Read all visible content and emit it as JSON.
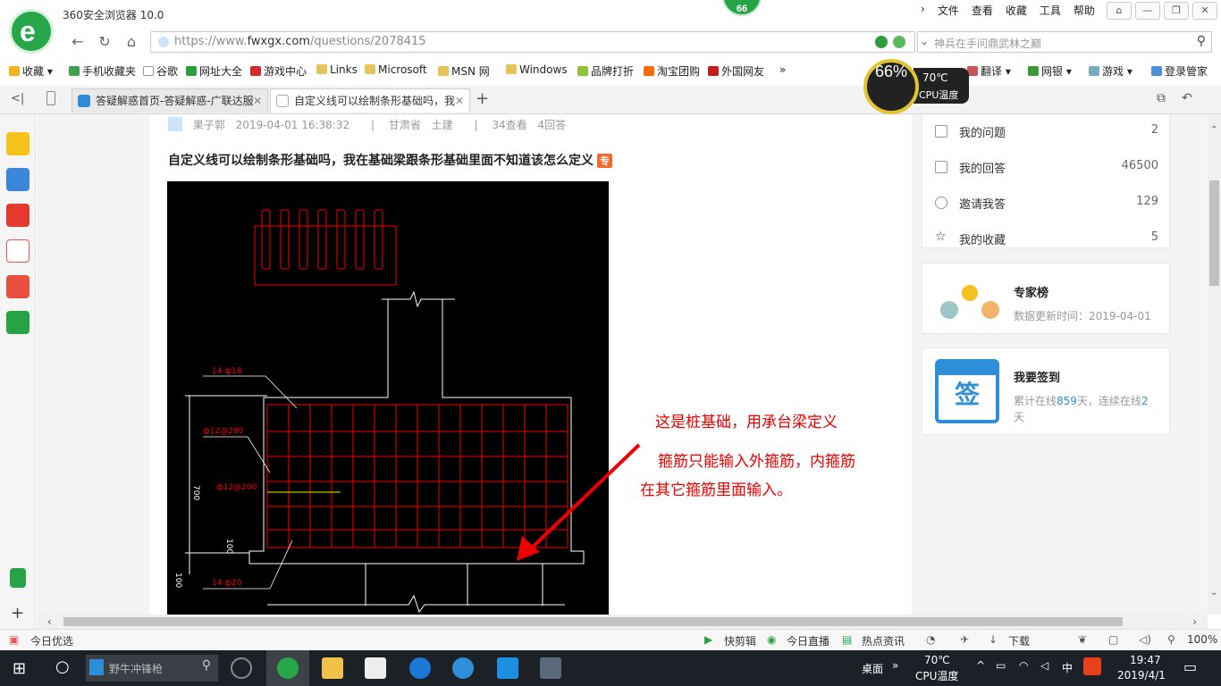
{
  "browser": {
    "app_title": "360安全浏览器 10.0",
    "badge": "66",
    "menu": [
      "文件",
      "查看",
      "收藏",
      "工具",
      "帮助"
    ],
    "url_prefix": "https://www.",
    "url_domain": "fwxgx.com",
    "url_path": "/questions/2078415",
    "search_placeholder": "神兵在手问鼎武林之巅"
  },
  "bookmarks": [
    {
      "label": "收藏",
      "color": "#f2b51d"
    },
    {
      "label": "手机收藏夹",
      "color": "#3fa34d"
    },
    {
      "label": "谷歌",
      "color": "#bbbbbb"
    },
    {
      "label": "网址大全",
      "color": "#2e9e3c"
    },
    {
      "label": "游戏中心",
      "color": "#d42a2a"
    },
    {
      "label": "Links",
      "color": "#e8c25a"
    },
    {
      "label": "Microsoft",
      "color": "#e8c25a"
    },
    {
      "label": "MSN 网",
      "color": "#e8c25a"
    },
    {
      "label": "Windows",
      "color": "#e8c25a"
    },
    {
      "label": "品牌打折",
      "color": "#8fc33a"
    },
    {
      "label": "淘宝团购",
      "color": "#ff6a00"
    },
    {
      "label": "外国网友",
      "color": "#c81b1b"
    },
    {
      "label": "翻译",
      "color": "#c55"
    },
    {
      "label": "网银",
      "color": "#3a9a3a"
    },
    {
      "label": "游戏",
      "color": "#7ab"
    },
    {
      "label": "登录管家",
      "color": "#4a90d9"
    }
  ],
  "tabs": [
    {
      "label": "答疑解惑首页-答疑解惑-广联达服",
      "active": false,
      "color": "#2f8bd8"
    },
    {
      "label": "自定义线可以绘制条形基础吗，我",
      "active": true,
      "color": "#cccccc"
    }
  ],
  "cpu": {
    "percent": "66%",
    "temp": "70℃",
    "label": "CPU温度"
  },
  "question": {
    "author": "果子郭",
    "date": "2019-04-01 16:38:32",
    "location": "甘肃省",
    "category": "土建",
    "views": "34查看",
    "answers": "4回答",
    "title": "自定义线可以绘制条形基础吗，我在基础梁跟条形基础里面不知道该怎么定义",
    "badge": "专"
  },
  "cad_labels": {
    "top_rebar": "14 ф18",
    "stirrup": "ф12@280",
    "mid_rebar": "ф12@200",
    "height": "700",
    "base": "100",
    "bottom_rebar": "14 ф20",
    "small": "100"
  },
  "annotation": {
    "line1": "这是桩基础，用承台梁定义",
    "line2": "箍筋只能输入外箍筋，内箍筋",
    "line3": "在其它箍筋里面输入。"
  },
  "user_stats": [
    {
      "label": "我的问题",
      "value": "2"
    },
    {
      "label": "我的回答",
      "value": "46500"
    },
    {
      "label": "邀请我答",
      "value": "129"
    },
    {
      "label": "我的收藏",
      "value": "5"
    }
  ],
  "expert": {
    "title": "专家榜",
    "subtitle": "数据更新时间：2019-04-01"
  },
  "signin": {
    "title": "我要签到",
    "icon_text": "签",
    "line_a": "累计在线",
    "days_total": "859",
    "line_b": "天，连续在线",
    "days_streak": "2",
    "line_c": "天"
  },
  "statusbar": {
    "left": "今日优选",
    "items": [
      "快剪辑",
      "今日直播",
      "热点资讯",
      "下载"
    ],
    "zoom": "100%"
  },
  "taskbar": {
    "search_placeholder": "野牛冲锋枪",
    "desktop": "桌面",
    "temp": "70℃",
    "temp_label": "CPU温度",
    "ime": "中",
    "time": "19:47",
    "date": "2019/4/1"
  }
}
